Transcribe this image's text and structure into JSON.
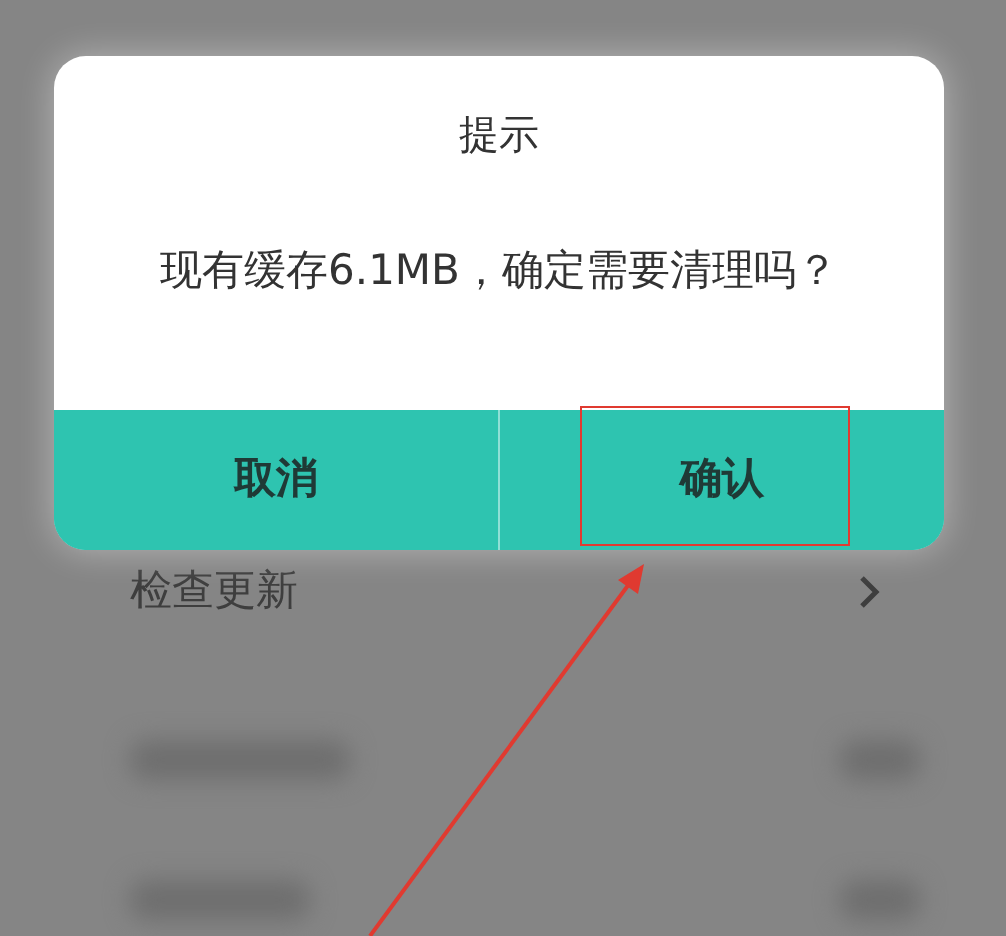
{
  "dialog": {
    "title": "提示",
    "message": "现有缓存6.1MB，确定需要清理吗？",
    "buttons": [
      {
        "label": "取消",
        "highlighted": false
      },
      {
        "label": "确认",
        "highlighted": true
      }
    ]
  },
  "background": {
    "items": [
      {
        "label": "检查更新",
        "kind": "link"
      }
    ]
  }
}
